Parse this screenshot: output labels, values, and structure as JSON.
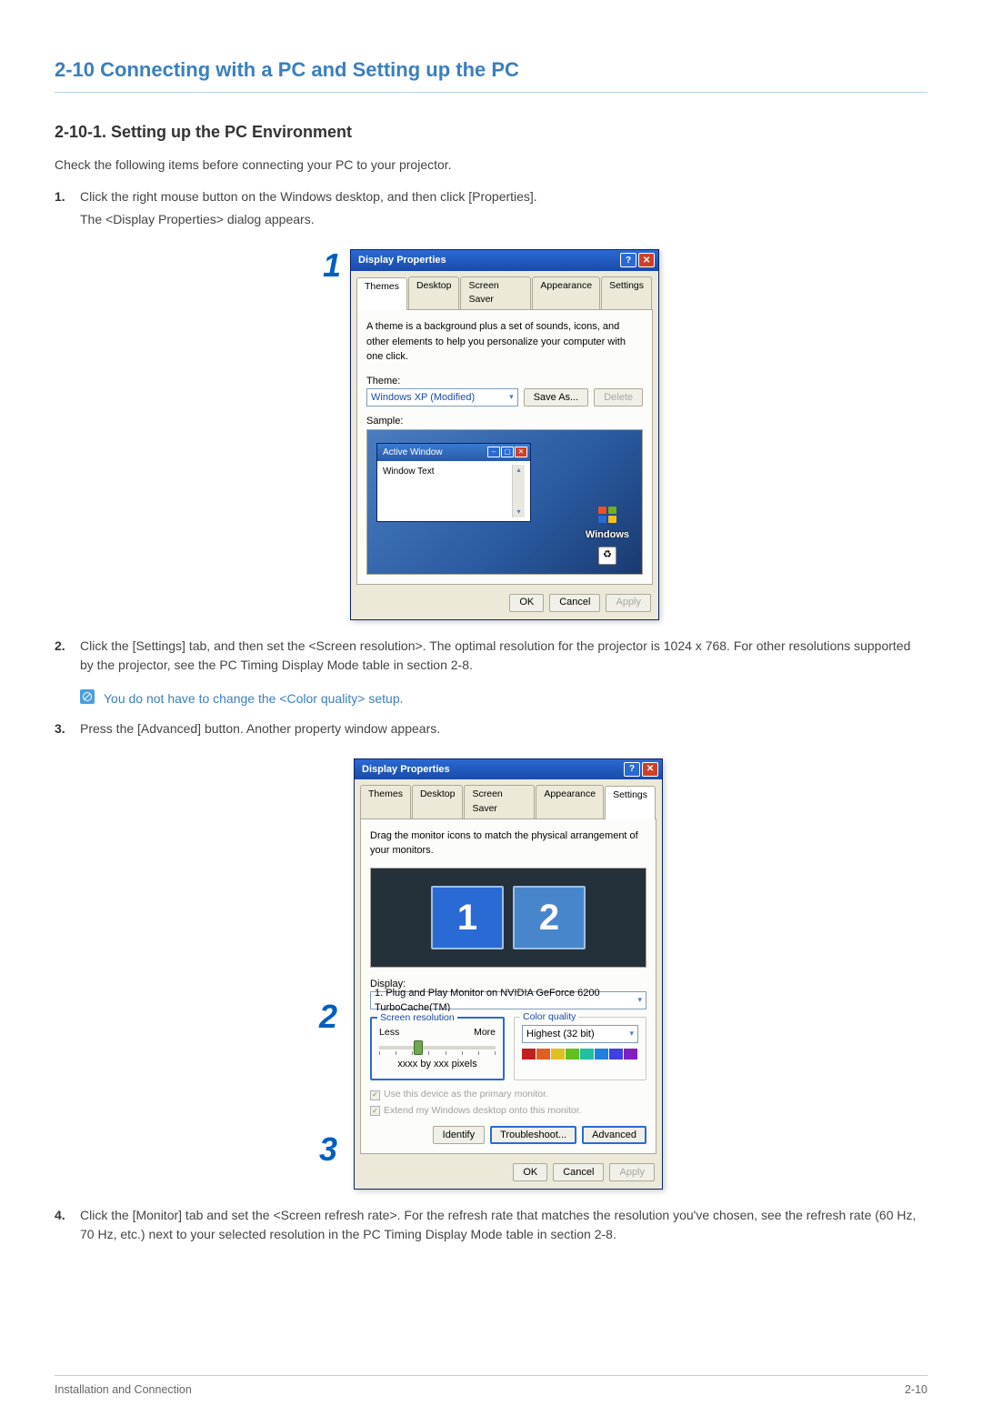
{
  "section_title": "2-10 Connecting with a PC and Setting up the PC",
  "sub_title": "2-10-1. Setting up the PC Environment",
  "intro": "Check the following items before connecting your PC to your projector.",
  "steps": {
    "s1": {
      "num": "1.",
      "line1": "Click the right mouse button on the Windows desktop, and then click [Properties].",
      "line2": "The <Display Properties> dialog appears."
    },
    "s2": {
      "num": "2.",
      "text": "Click the [Settings] tab, and then set the <Screen resolution>. The optimal resolution for the projector is 1024 x 768. For other resolutions supported by the projector, see the PC Timing Display Mode table in section 2-8."
    },
    "note2": "You do not have to change the <Color quality> setup.",
    "s3": {
      "num": "3.",
      "text": "Press the [Advanced] button. Another property window appears."
    },
    "s4": {
      "num": "4.",
      "text": "Click the [Monitor] tab and set the <Screen refresh rate>. For the refresh rate that matches the resolution you've chosen, see the refresh rate (60 Hz, 70 Hz, etc.) next to your selected resolution in the PC Timing Display Mode table in section 2-8."
    }
  },
  "callouts": {
    "one": "1",
    "two": "2",
    "three": "3"
  },
  "dlg1": {
    "title": "Display Properties",
    "tabs": {
      "themes": "Themes",
      "desktop": "Desktop",
      "ss": "Screen Saver",
      "appearance": "Appearance",
      "settings": "Settings"
    },
    "desc": "A theme is a background plus a set of sounds, icons, and other elements to help you personalize your computer with one click.",
    "theme_lbl": "Theme:",
    "theme_val": "Windows XP (Modified)",
    "saveas": "Save As...",
    "delete": "Delete",
    "sample_lbl": "Sample:",
    "active_window": "Active Window",
    "window_text": "Window Text",
    "win_logo": "Windows",
    "ok": "OK",
    "cancel": "Cancel",
    "apply": "Apply"
  },
  "dlg2": {
    "title": "Display Properties",
    "tabs": {
      "themes": "Themes",
      "desktop": "Desktop",
      "ss": "Screen Saver",
      "appearance": "Appearance",
      "settings": "Settings"
    },
    "drag_text": "Drag the monitor icons to match the physical arrangement of your monitors.",
    "mon1": "1",
    "mon2": "2",
    "display_lbl": "Display:",
    "display_val": "1. Plug and Play Monitor on NVIDIA GeForce 6200 TurboCache(TM)",
    "sr_lbl": "Screen resolution",
    "less": "Less",
    "more": "More",
    "sr_val": "xxxx by xxx pixels",
    "cq_lbl": "Color quality",
    "cq_val": "Highest (32 bit)",
    "chk1": "Use this device as the primary monitor.",
    "chk2": "Extend my Windows desktop onto this monitor.",
    "identify": "Identify",
    "troubleshoot": "Troubleshoot...",
    "advanced": "Advanced",
    "ok": "OK",
    "cancel": "Cancel",
    "apply": "Apply"
  },
  "footer": {
    "left": "Installation and Connection",
    "right": "2-10"
  }
}
